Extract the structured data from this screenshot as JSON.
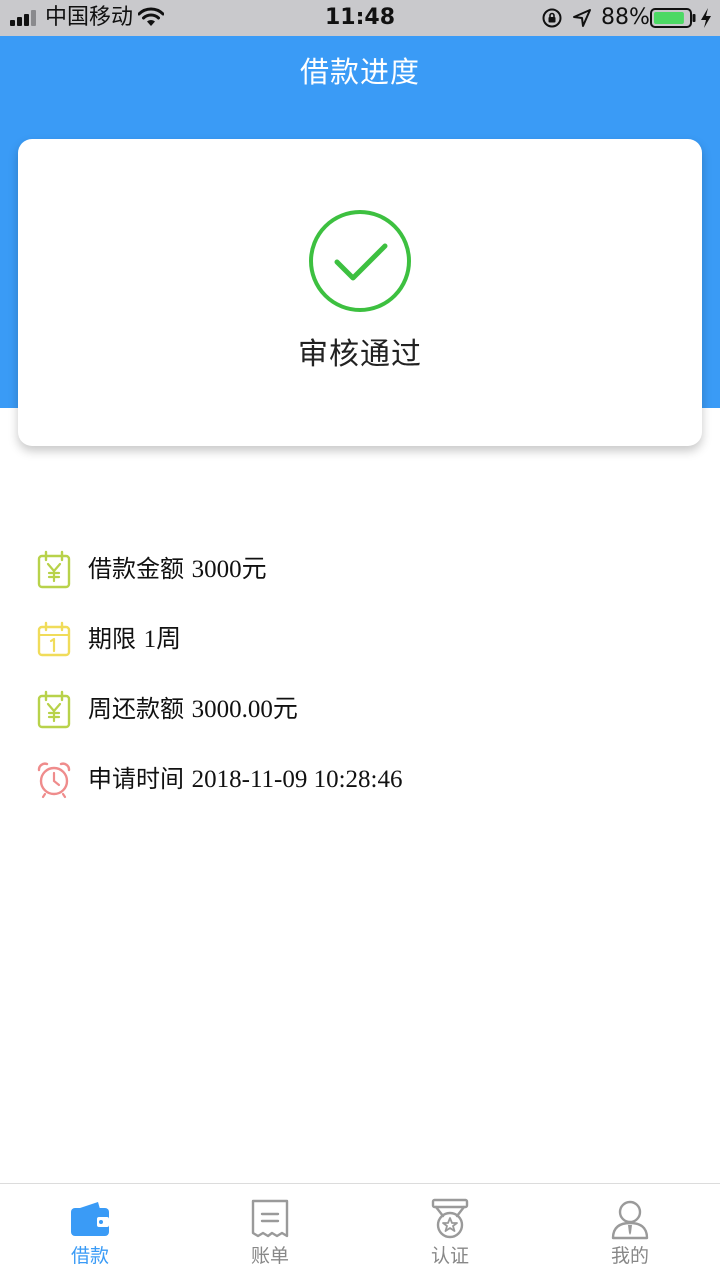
{
  "status_bar": {
    "carrier": "中国移动",
    "time": "11:48",
    "battery_percent": "88%",
    "battery_level": 0.88
  },
  "header": {
    "title": "借款进度"
  },
  "status_card": {
    "status": "审核通过",
    "accent_color": "#3dc040"
  },
  "details": [
    {
      "label": "借款金额",
      "value": "3000元",
      "icon": "calendar-yen-icon",
      "color": "#b8d24a"
    },
    {
      "label": "期限",
      "value": "1周",
      "icon": "calendar-one-icon",
      "color": "#f0dc5a"
    },
    {
      "label": "周还款额",
      "value": "3000.00元",
      "icon": "calendar-yen-icon",
      "color": "#b8d24a"
    },
    {
      "label": "申请时间",
      "value": "2018-11-09 10:28:46",
      "icon": "alarm-clock-icon",
      "color": "#ef8c8c"
    }
  ],
  "tabs": [
    {
      "label": "借款",
      "icon": "wallet-icon",
      "active": true
    },
    {
      "label": "账单",
      "icon": "bill-icon",
      "active": false
    },
    {
      "label": "认证",
      "icon": "badge-icon",
      "active": false
    },
    {
      "label": "我的",
      "icon": "user-icon",
      "active": false
    }
  ],
  "colors": {
    "primary": "#3a9bf6",
    "tab_inactive": "#888888"
  }
}
